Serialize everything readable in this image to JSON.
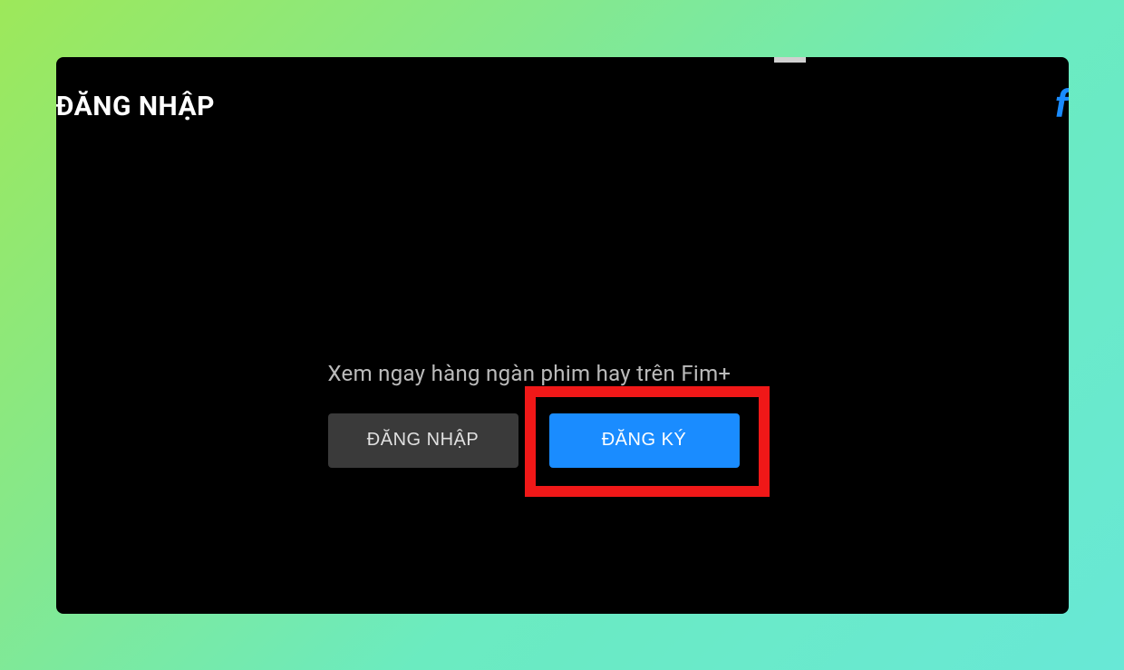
{
  "header": {
    "title": "ĐĂNG NHẬP",
    "logo_text": "f"
  },
  "main": {
    "tagline": "Xem ngay hàng ngàn phim hay trên Fim+",
    "login_button_label": "ĐĂNG NHẬP",
    "register_button_label": "ĐĂNG KÝ"
  }
}
